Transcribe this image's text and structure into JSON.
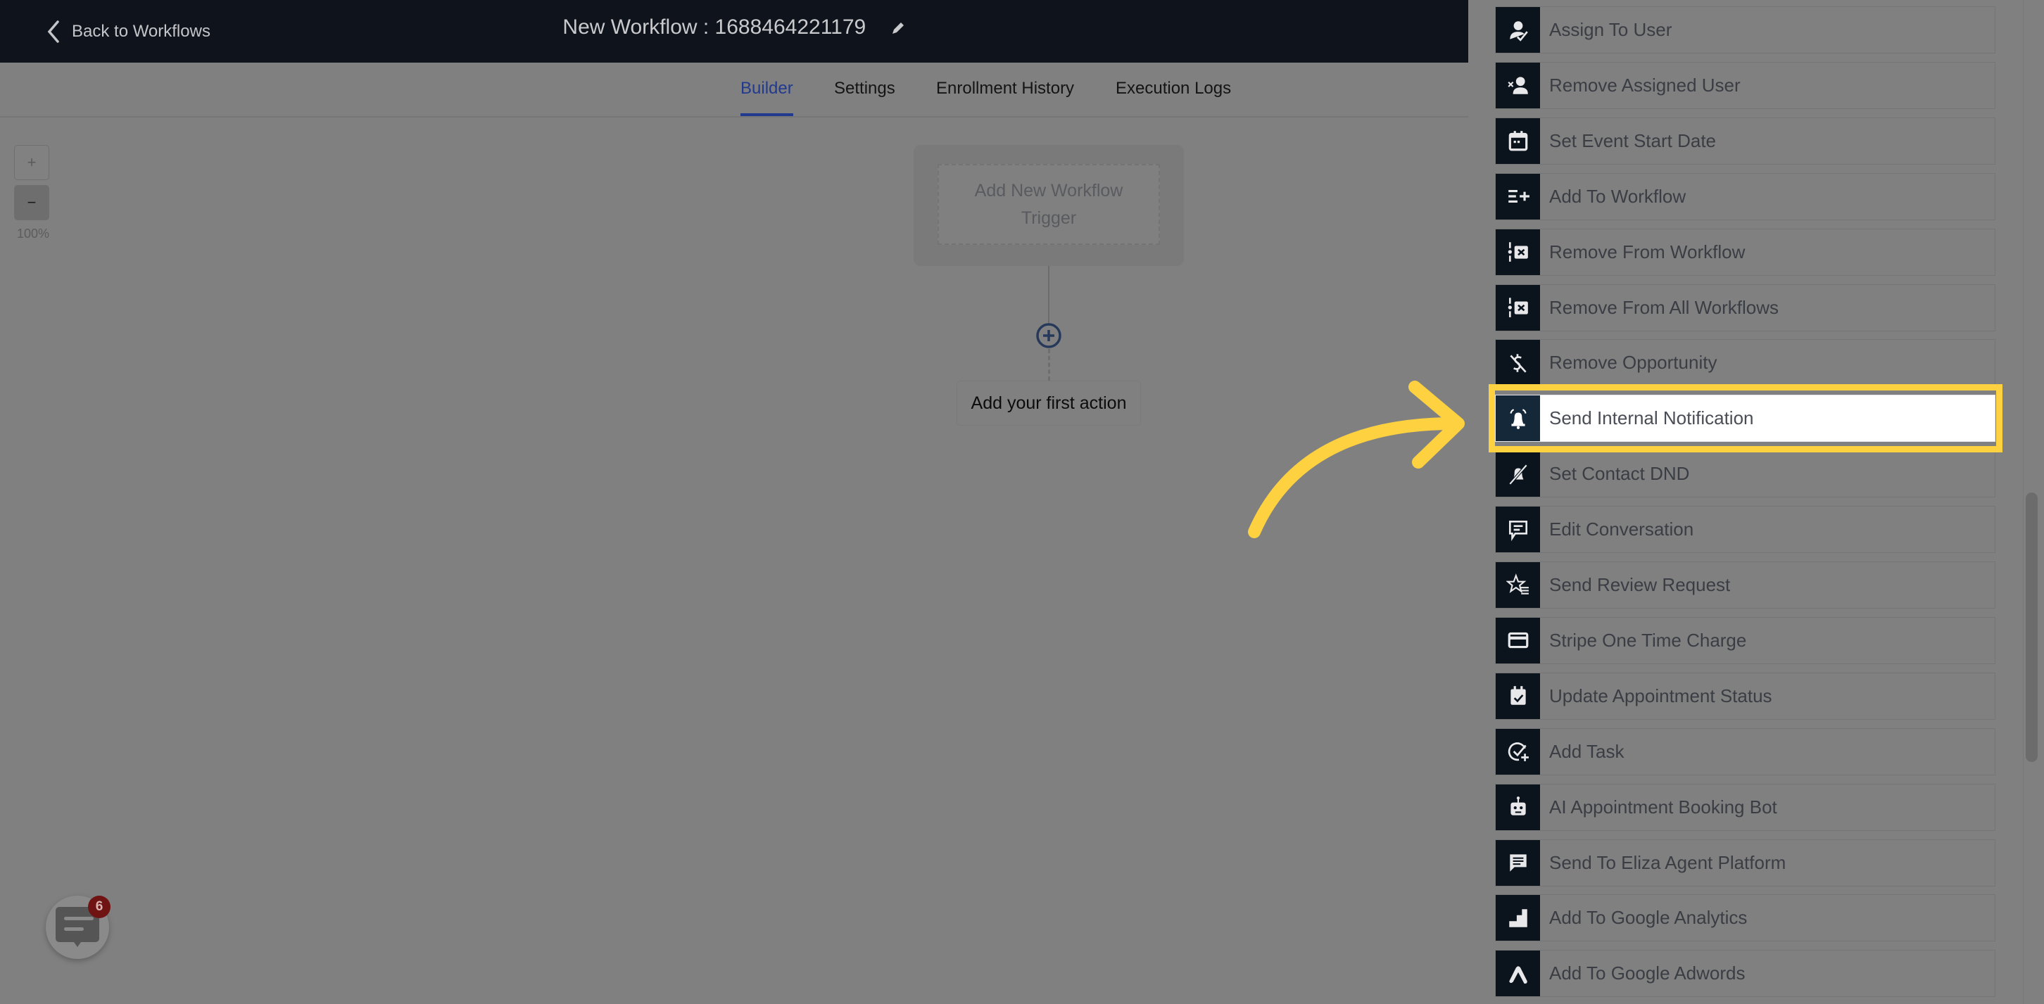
{
  "header": {
    "back_label": "Back to Workflows",
    "title": "New Workflow : 1688464221179"
  },
  "tabs": [
    {
      "label": "Builder",
      "active": true
    },
    {
      "label": "Settings",
      "active": false
    },
    {
      "label": "Enrollment History",
      "active": false
    },
    {
      "label": "Execution Logs",
      "active": false
    }
  ],
  "zoom": {
    "plus": "+",
    "minus": "−",
    "level": "100%"
  },
  "canvas": {
    "trigger_label": "Add New Workflow Trigger",
    "first_action_label": "Add your first action"
  },
  "chat": {
    "badge_count": "6"
  },
  "actions": [
    {
      "label": "Assign To User",
      "icon": "user-check"
    },
    {
      "label": "Remove Assigned User",
      "icon": "user-remove"
    },
    {
      "label": "Set Event Start Date",
      "icon": "calendar"
    },
    {
      "label": "Add To Workflow",
      "icon": "list-plus"
    },
    {
      "label": "Remove From Workflow",
      "icon": "workflow-remove"
    },
    {
      "label": "Remove From All Workflows",
      "icon": "workflow-remove"
    },
    {
      "label": "Remove Opportunity",
      "icon": "dollar-off"
    },
    {
      "label": "Send Internal Notification",
      "icon": "bell-ring",
      "highlighted": true
    },
    {
      "label": "Set Contact DND",
      "icon": "bell-off"
    },
    {
      "label": "Edit Conversation",
      "icon": "message"
    },
    {
      "label": "Send Review Request",
      "icon": "star-list"
    },
    {
      "label": "Stripe One Time Charge",
      "icon": "credit-card"
    },
    {
      "label": "Update Appointment Status",
      "icon": "calendar-check"
    },
    {
      "label": "Add Task",
      "icon": "check-circle-plus"
    },
    {
      "label": "AI Appointment Booking Bot",
      "icon": "robot"
    },
    {
      "label": "Send To Eliza Agent Platform",
      "icon": "chat-filled"
    },
    {
      "label": "Add To Google Analytics",
      "icon": "analytics"
    },
    {
      "label": "Add To Google Adwords",
      "icon": "adwords"
    }
  ],
  "colors": {
    "topbar": "#0f131b",
    "active_tab": "#223a8e",
    "highlight": "#fdd13f",
    "icon_bg": "#0b141d",
    "badge": "#6f1412"
  }
}
